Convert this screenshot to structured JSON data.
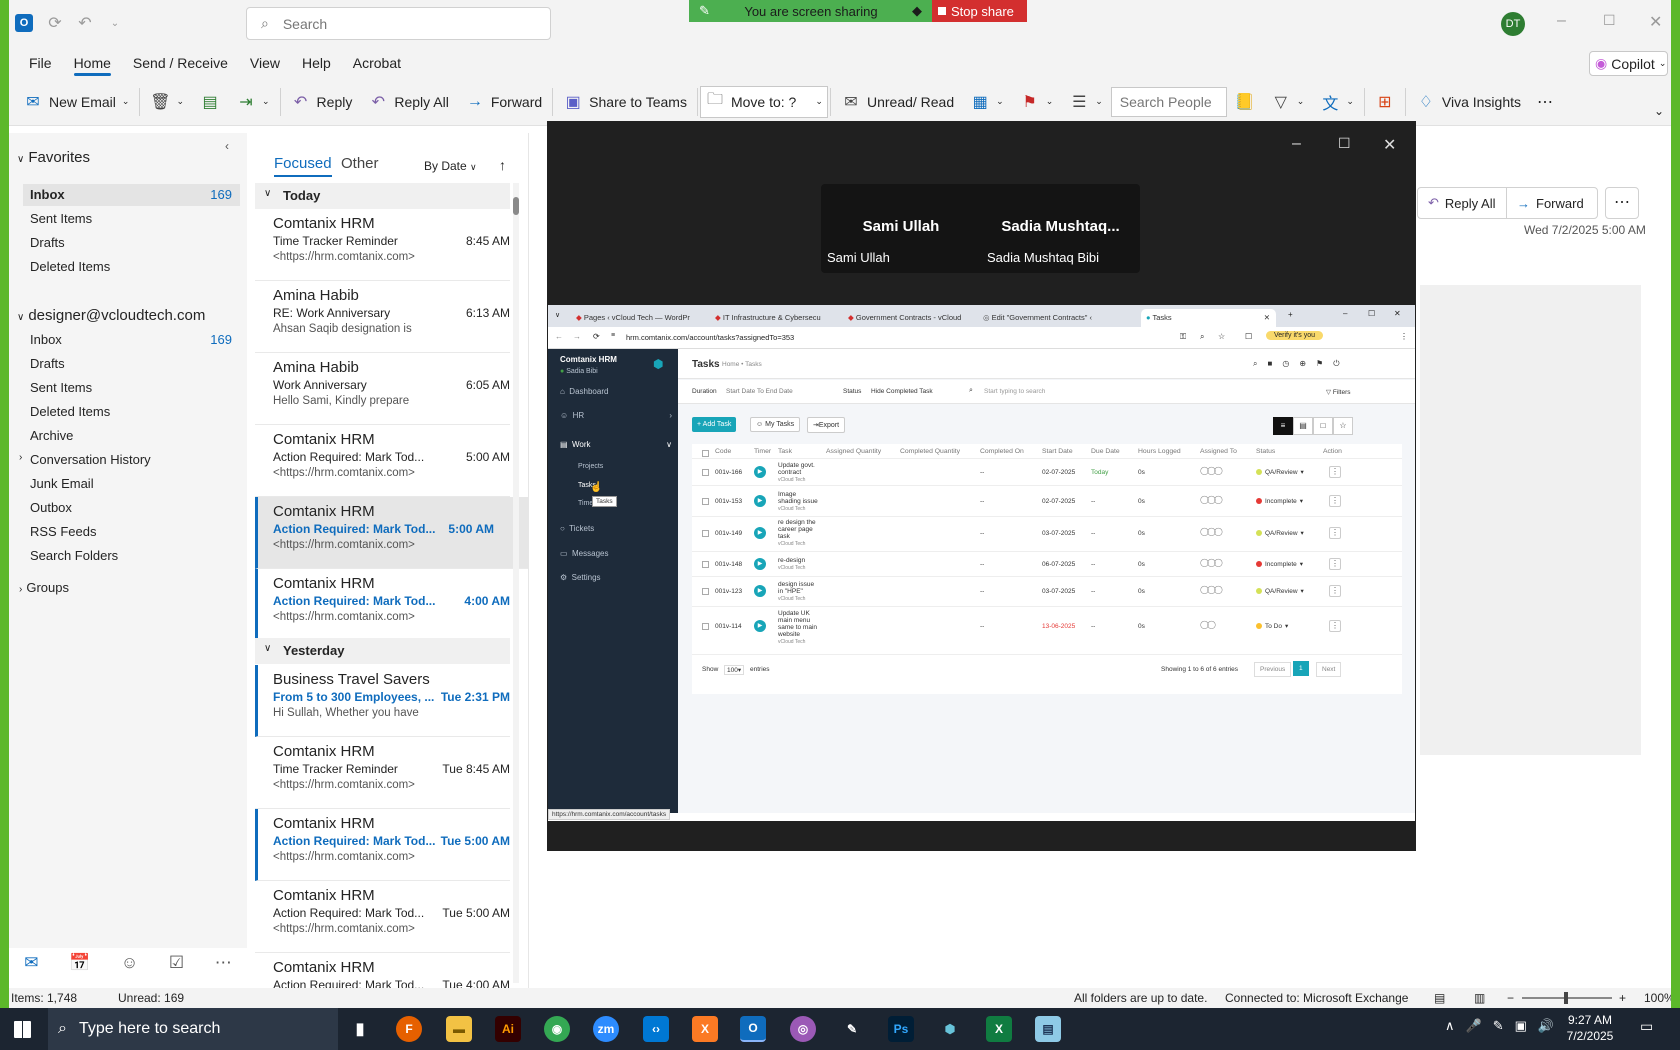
{
  "share": {
    "status": "You are screen sharing",
    "stop": "Stop share"
  },
  "title": {
    "search_placeholder": "Search",
    "avatar": "DT"
  },
  "tabs": [
    "File",
    "Home",
    "Send / Receive",
    "View",
    "Help",
    "Acrobat"
  ],
  "copilot": "Copilot",
  "ribbon": {
    "new_email": "New Email",
    "reply": "Reply",
    "reply_all": "Reply All",
    "forward": "Forward",
    "share_teams": "Share to Teams",
    "move_to": "Move to: ?",
    "unread_read": "Unread/ Read",
    "search_people": "Search People",
    "viva": "Viva Insights"
  },
  "favorites": {
    "header": "Favorites",
    "items": [
      {
        "label": "Inbox",
        "count": "169"
      },
      {
        "label": "Sent Items",
        "count": ""
      },
      {
        "label": "Drafts",
        "count": ""
      },
      {
        "label": "Deleted Items",
        "count": ""
      }
    ]
  },
  "account": {
    "header": "designer@vcloudtech.com",
    "items": [
      {
        "label": "Inbox",
        "count": "169"
      },
      {
        "label": "Drafts",
        "count": ""
      },
      {
        "label": "Sent Items",
        "count": ""
      },
      {
        "label": "Deleted Items",
        "count": ""
      },
      {
        "label": "Archive",
        "count": ""
      },
      {
        "label": "Conversation History",
        "count": ""
      },
      {
        "label": "Junk Email",
        "count": ""
      },
      {
        "label": "Outbox",
        "count": ""
      },
      {
        "label": "RSS Feeds",
        "count": ""
      },
      {
        "label": "Search Folders",
        "count": ""
      }
    ]
  },
  "groups": "Groups",
  "list": {
    "focused": "Focused",
    "other": "Other",
    "sort": "By Date",
    "today": "Today",
    "yesterday": "Yesterday",
    "messages": [
      {
        "from": "Comtanix HRM",
        "subject": "Time Tracker Reminder",
        "time": "8:45 AM",
        "preview": "<https://hrm.comtanix.com>"
      },
      {
        "from": "Amina Habib",
        "subject": "RE: Work Anniversary",
        "time": "6:13 AM",
        "preview": "Ahsan Saqib designation is"
      },
      {
        "from": "Amina Habib",
        "subject": "Work Anniversary",
        "time": "6:05 AM",
        "preview": "Hello Sami,  Kindly prepare"
      },
      {
        "from": "Comtanix HRM",
        "subject": "Action Required: Mark Tod...",
        "time": "5:00 AM",
        "preview": "<https://hrm.comtanix.com>"
      },
      {
        "from": "Comtanix HRM",
        "subject": "Action Required: Mark Tod...",
        "time": "5:00 AM",
        "preview": "<https://hrm.comtanix.com>"
      },
      {
        "from": "Comtanix HRM",
        "subject": "Action Required: Mark Tod...",
        "time": "4:00 AM",
        "preview": "<https://hrm.comtanix.com>"
      },
      {
        "from": "Business Travel Savers",
        "subject": "From 5 to 300 Employees, ...",
        "time": "Tue 2:31 PM",
        "preview": "Hi Sullah,  Whether you have"
      },
      {
        "from": "Comtanix HRM",
        "subject": "Time Tracker Reminder",
        "time": "Tue 8:45 AM",
        "preview": "<https://hrm.comtanix.com>"
      },
      {
        "from": "Comtanix HRM",
        "subject": "Action Required: Mark Tod...",
        "time": "Tue 5:00 AM",
        "preview": "<https://hrm.comtanix.com>"
      },
      {
        "from": "Comtanix HRM",
        "subject": "Action Required: Mark Tod...",
        "time": "Tue 5:00 AM",
        "preview": "<https://hrm.comtanix.com>"
      },
      {
        "from": "Comtanix HRM",
        "subject": "Action Required: Mark Tod...",
        "time": "Tue 4:00 AM",
        "preview": ""
      }
    ]
  },
  "reading": {
    "reply_all": "Reply All",
    "forward": "Forward",
    "date": "Wed 7/2/2025 5:00 AM"
  },
  "meeting": {
    "p1_name": "Sami Ullah",
    "p1_label": "Sami Ullah",
    "p2_name": "Sadia  Mushtaq...",
    "p2_label": "Sadia Mushtaq Bibi"
  },
  "browser": {
    "tabs": [
      "Pages ‹ vCloud Tech — WordPr",
      "IT Infrastructure & Cybersecu",
      "Government Contracts - vCloud",
      "Edit \"Government Contracts\" ‹",
      "Tasks"
    ],
    "url": "hrm.comtanix.com/account/tasks?assignedTo=353",
    "verify": "Verify it's you",
    "status_url": "https://hrm.comtanix.com/account/tasks"
  },
  "hrm": {
    "brand": "Comtanix HRM",
    "user": "Sadia Bibi",
    "nav": [
      "Dashboard",
      "HR",
      "Work",
      "Projects",
      "Tasks",
      "Time",
      "Tickets",
      "Messages",
      "Settings"
    ],
    "tooltip": "Tasks",
    "page_title": "Tasks",
    "crumb": "Home • Tasks",
    "duration_label": "Duration",
    "duration_value": "Start Date To End Date",
    "status_label": "Status",
    "status_value": "Hide Completed Task",
    "search_placeholder": "Start typing to search",
    "filters": "Filters",
    "add_task": "+ Add Task",
    "my_tasks": "My Tasks",
    "export": "Export",
    "columns": [
      "Code",
      "Timer",
      "Task",
      "Assigned Quantity",
      "Completed Quantity",
      "Completed On",
      "Start Date",
      "Due Date",
      "Hours Logged",
      "Assigned To",
      "Status",
      "Action"
    ],
    "rows": [
      {
        "code": "001v-166",
        "task": [
          "Update govt.",
          "contract"
        ],
        "company": "vCloud Tech",
        "completed_on": "--",
        "start": "02-07-2025",
        "due": "Today",
        "hours": "0s",
        "status": "QA/Review",
        "status_color": "#d4e157"
      },
      {
        "code": "001v-153",
        "task": [
          "Image",
          "shading issue"
        ],
        "company": "vCloud Tech",
        "completed_on": "--",
        "start": "02-07-2025",
        "due": "--",
        "hours": "0s",
        "status": "Incomplete",
        "status_color": "#e53935"
      },
      {
        "code": "001v-149",
        "task": [
          "re design the",
          "career page",
          "task"
        ],
        "company": "vCloud Tech",
        "completed_on": "--",
        "start": "03-07-2025",
        "due": "--",
        "hours": "0s",
        "status": "QA/Review",
        "status_color": "#d4e157"
      },
      {
        "code": "001v-148",
        "task": [
          "re-design"
        ],
        "company": "vCloud Tech",
        "completed_on": "--",
        "start": "06-07-2025",
        "due": "--",
        "hours": "0s",
        "status": "Incomplete",
        "status_color": "#e53935"
      },
      {
        "code": "001v-123",
        "task": [
          "design issue",
          "in \"HPE\""
        ],
        "company": "vCloud Tech",
        "completed_on": "--",
        "start": "03-07-2025",
        "due": "--",
        "hours": "0s",
        "status": "QA/Review",
        "status_color": "#d4e157"
      },
      {
        "code": "001v-114",
        "task": [
          "Update UK",
          "main menu",
          "same to main",
          "website"
        ],
        "company": "vCloud Tech",
        "completed_on": "--",
        "start": "13-06-2025",
        "due": "--",
        "hours": "0s",
        "status": "To Do",
        "status_color": "#fbc02d"
      }
    ],
    "show_label": "Show",
    "show_value": "100",
    "entries": "entries",
    "showing": "Showing 1 to 6 of 6 entries",
    "prev": "Previous",
    "page": "1",
    "next": "Next"
  },
  "statusbar": {
    "items": "Items: 1,748",
    "unread": "Unread: 169",
    "sync": "All folders are up to date.",
    "conn": "Connected to: Microsoft Exchange",
    "zoom": "100%"
  },
  "taskbar": {
    "search": "Type here to search",
    "time": "9:27 AM",
    "date": "7/2/2025"
  }
}
